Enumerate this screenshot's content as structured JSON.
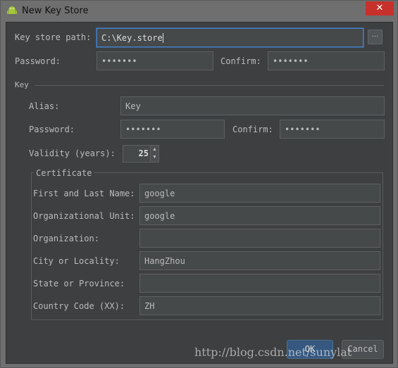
{
  "window": {
    "title": "New Key Store",
    "close_label": "✕"
  },
  "keystore": {
    "path_label": "Key store path:",
    "path_value": "C:\\Key.store",
    "browse_label": "...",
    "password_label": "Password:",
    "password_value": "•••••••",
    "confirm_label": "Confirm:",
    "confirm_value": "•••••••"
  },
  "key": {
    "section_label": "Key",
    "alias_label": "Alias:",
    "alias_value": "Key",
    "password_label": "Password:",
    "password_value": "•••••••",
    "confirm_label": "Confirm:",
    "confirm_value": "•••••••",
    "validity_label": "Validity (years):",
    "validity_value": "25"
  },
  "certificate": {
    "title": "Certificate",
    "fields": [
      {
        "label": "First and Last Name:",
        "value": "google"
      },
      {
        "label": "Organizational Unit:",
        "value": "google"
      },
      {
        "label": "Organization:",
        "value": ""
      },
      {
        "label": "City or Locality:",
        "value": "HangZhou"
      },
      {
        "label": "State or Province:",
        "value": ""
      },
      {
        "label": "Country Code (XX):",
        "value": "ZH"
      }
    ]
  },
  "buttons": {
    "ok": "OK",
    "cancel": "Cancel"
  },
  "watermark": "http://blog.csdn.net/sunylat"
}
